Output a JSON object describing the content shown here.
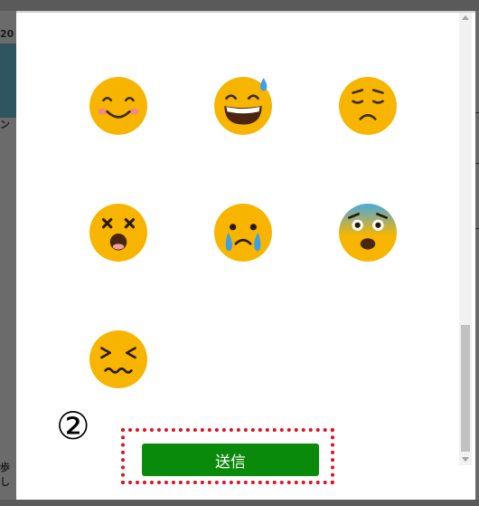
{
  "background": {
    "snippet_top": "20",
    "snippet_mid": "ン",
    "snippet_bottom_1": "歩",
    "snippet_bottom_2": "し"
  },
  "dialog": {
    "emojis": [
      {
        "icon": "smiling-blush-face-icon"
      },
      {
        "icon": "grinning-sweat-face-icon"
      },
      {
        "icon": "frowning-face-icon"
      },
      {
        "icon": "dizzy-face-icon"
      },
      {
        "icon": "crying-face-icon"
      },
      {
        "icon": "fearful-face-icon"
      },
      {
        "icon": "confounded-face-icon"
      }
    ],
    "step_label": "②",
    "submit_label": "送信"
  },
  "colors": {
    "emoji_yellow": "#f7b500",
    "submit_green": "#0a8a0a",
    "highlight_red": "#e01020"
  }
}
